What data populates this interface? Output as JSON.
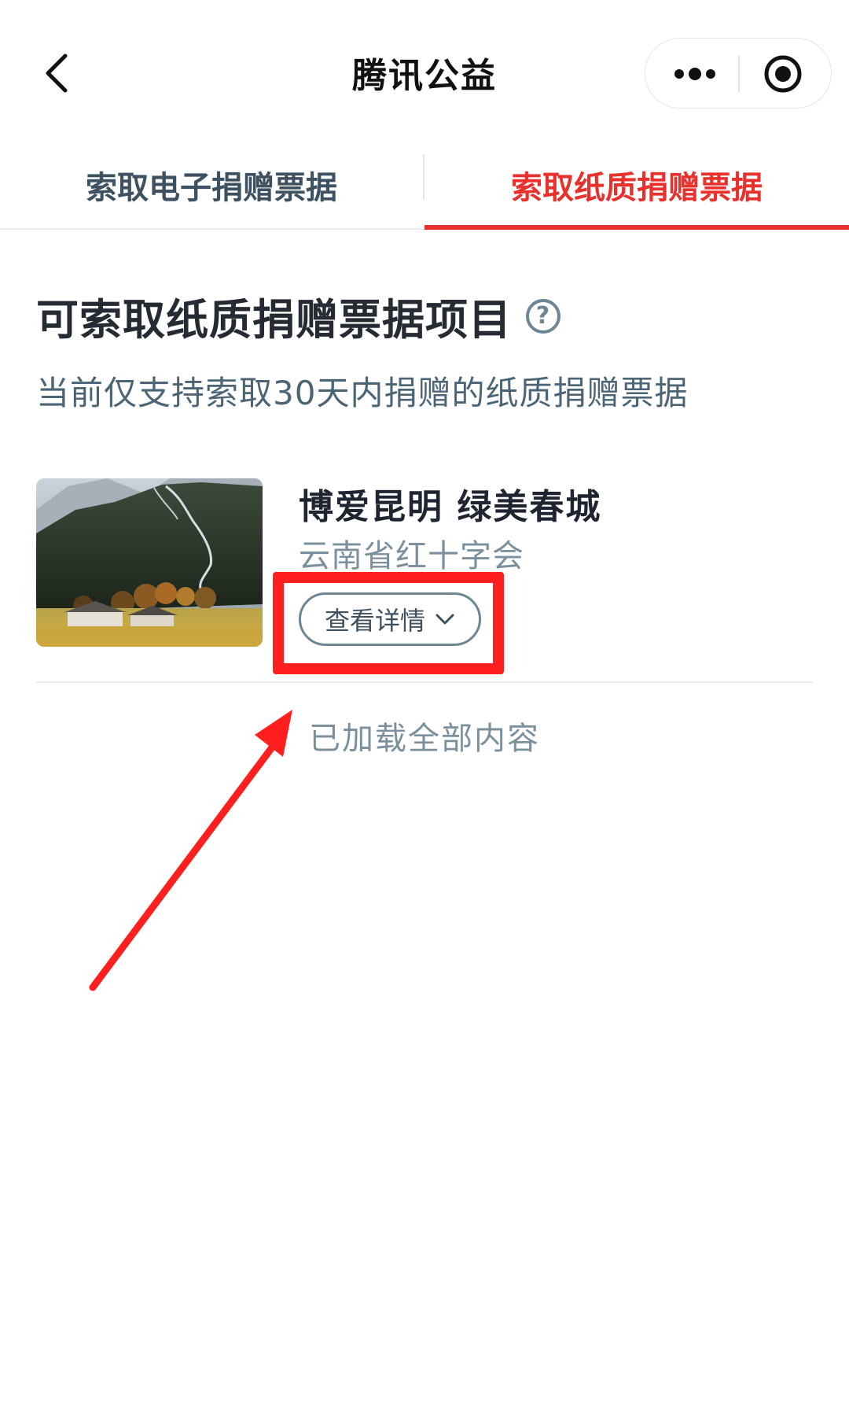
{
  "navbar": {
    "title": "腾讯公益",
    "back_icon": "chevron-left-icon",
    "more_icon": "more-dots-icon",
    "close_icon": "target-close-icon"
  },
  "tabs": [
    {
      "label": "索取电子捐赠票据",
      "active": false
    },
    {
      "label": "索取纸质捐赠票据",
      "active": true
    }
  ],
  "section": {
    "title": "可索取纸质捐赠票据项目",
    "help_icon": "question-circle-icon",
    "help_glyph": "?",
    "subtitle": "当前仅支持索取30天内捐赠的纸质捐赠票据"
  },
  "projects": [
    {
      "name": "博爱昆明 绿美春城",
      "organization": "云南省红十字会",
      "details_label": "查看详情",
      "thumbnail": "mountain-village-landscape"
    }
  ],
  "footer": {
    "status": "已加载全部内容"
  },
  "colors": {
    "accent": "#e8312c",
    "tab_inactive": "#3e5161",
    "subtitle": "#4c6576",
    "muted": "#7b909d",
    "annotation": "#ff1f1f"
  }
}
